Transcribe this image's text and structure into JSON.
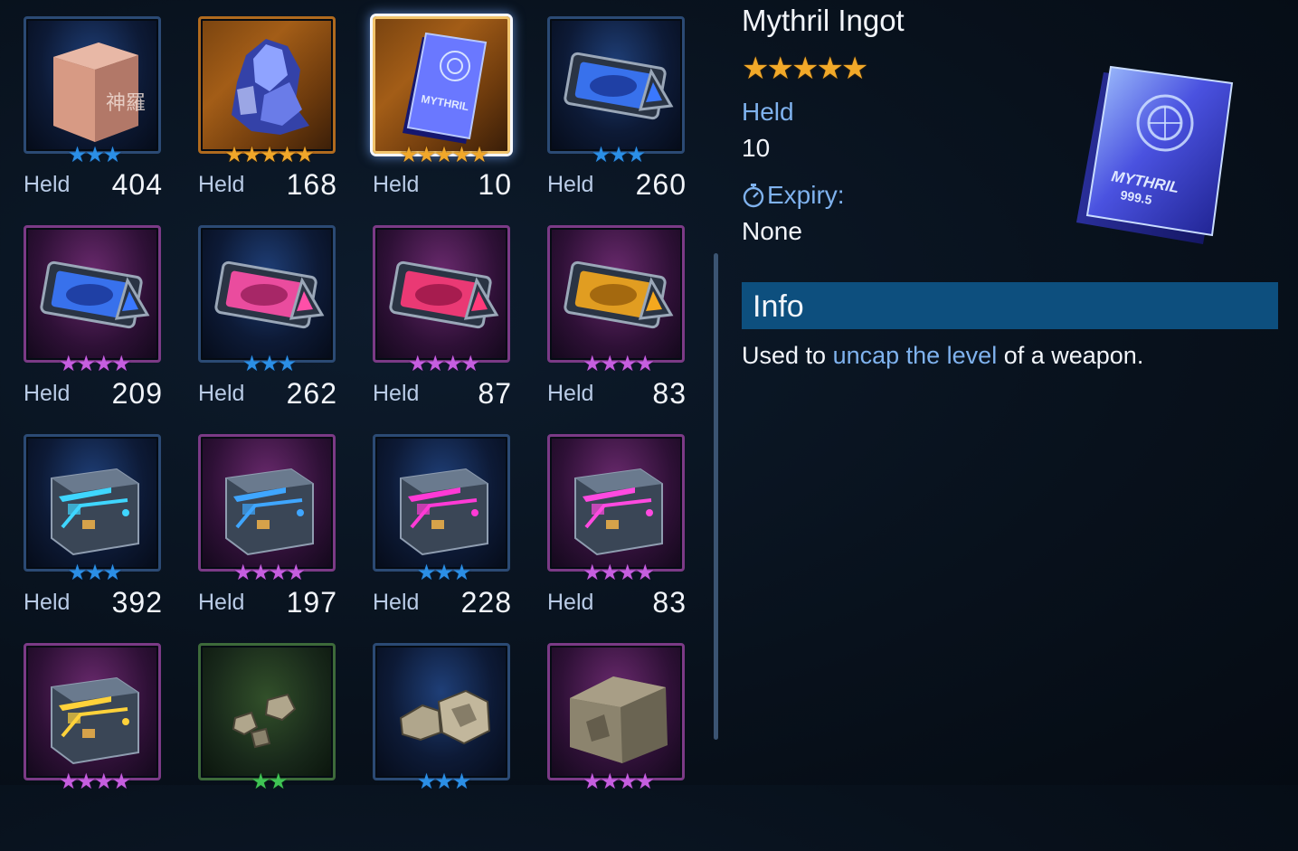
{
  "inventory": {
    "items": [
      {
        "name": "Shinra Copper Block",
        "rarity": 3,
        "stars": "★★★",
        "held_label": "Held",
        "held": "404",
        "art": "copper-cube",
        "colors": [
          "#d79a84",
          "#8c5a4c"
        ]
      },
      {
        "name": "Crystal Ore",
        "rarity": 5,
        "stars": "★★★★★",
        "held_label": "Held",
        "held": "168",
        "art": "crystal",
        "colors": [
          "#8fa3ff",
          "#3442a8"
        ]
      },
      {
        "name": "Mythril Ingot",
        "rarity": 5,
        "stars": "★★★★★",
        "held_label": "Held",
        "held": "10",
        "art": "ingot",
        "colors": [
          "#6a78ff",
          "#2a2fa8"
        ],
        "selected": true
      },
      {
        "name": "Blue Capsule",
        "rarity": 3,
        "stars": "★★★",
        "held_label": "Held",
        "held": "260",
        "art": "capsule",
        "colors": [
          "#3a78ff",
          "#162c88"
        ]
      },
      {
        "name": "Blue Capsule+",
        "rarity": 4,
        "stars": "★★★★",
        "held_label": "Held",
        "held": "209",
        "art": "capsule",
        "colors": [
          "#3a78ff",
          "#162c88"
        ]
      },
      {
        "name": "Pink Capsule",
        "rarity": 3,
        "stars": "★★★",
        "held_label": "Held",
        "held": "262",
        "art": "capsule",
        "colors": [
          "#ff4fa8",
          "#8a1850"
        ]
      },
      {
        "name": "Pink Capsule+",
        "rarity": 4,
        "stars": "★★★★",
        "held_label": "Held",
        "held": "87",
        "art": "capsule",
        "colors": [
          "#ff3a7a",
          "#8a1040"
        ]
      },
      {
        "name": "Gold Capsule+",
        "rarity": 4,
        "stars": "★★★★",
        "held_label": "Held",
        "held": "83",
        "art": "capsule",
        "colors": [
          "#f5a81e",
          "#8a5208"
        ]
      },
      {
        "name": "Cyan Crate",
        "rarity": 3,
        "stars": "★★★",
        "held_label": "Held",
        "held": "392",
        "art": "crate",
        "colors": [
          "#3fd6ff",
          "#1a5c78"
        ]
      },
      {
        "name": "Cyan Crate+",
        "rarity": 4,
        "stars": "★★★★",
        "held_label": "Held",
        "held": "197",
        "art": "crate",
        "colors": [
          "#3fa6ff",
          "#1a4c88"
        ]
      },
      {
        "name": "Magenta Crate",
        "rarity": 3,
        "stars": "★★★",
        "held_label": "Held",
        "held": "228",
        "art": "crate",
        "colors": [
          "#ff3ad6",
          "#7a1a68"
        ]
      },
      {
        "name": "Magenta Crate+",
        "rarity": 4,
        "stars": "★★★★",
        "held_label": "Held",
        "held": "83",
        "art": "crate",
        "colors": [
          "#ff4ae0",
          "#7a1a68"
        ]
      },
      {
        "name": "Yellow Crate+",
        "rarity": 4,
        "stars": "★★★★",
        "held_label": "Held",
        "held": "",
        "art": "crate",
        "colors": [
          "#ffd23a",
          "#7a5a10"
        ]
      },
      {
        "name": "Ore Chips",
        "rarity": 2,
        "stars": "★★",
        "held_label": "Held",
        "held": "",
        "art": "ore-small",
        "colors": [
          "#b0a68c",
          "#4a4436"
        ]
      },
      {
        "name": "Ore Chunks",
        "rarity": 3,
        "stars": "★★★",
        "held_label": "Held",
        "held": "",
        "art": "ore-medium",
        "colors": [
          "#b0a68c",
          "#4a4436"
        ]
      },
      {
        "name": "Ore Block",
        "rarity": 4,
        "stars": "★★★★",
        "held_label": "Held",
        "held": "",
        "art": "ore-large",
        "colors": [
          "#a89e86",
          "#4a4436"
        ]
      }
    ]
  },
  "detail": {
    "title": "Mythril Ingot",
    "stars": "★★★★★",
    "held_label": "Held",
    "held_value": "10",
    "expiry_icon": "stopwatch-icon",
    "expiry_label": "Expiry:",
    "expiry_value": "None",
    "info_heading": "Info",
    "desc_before": "Used to ",
    "desc_highlight": "uncap the level",
    "desc_after": " of a weapon.",
    "highlight_color": "#7fb2ee",
    "star_color": "#f2a929"
  }
}
